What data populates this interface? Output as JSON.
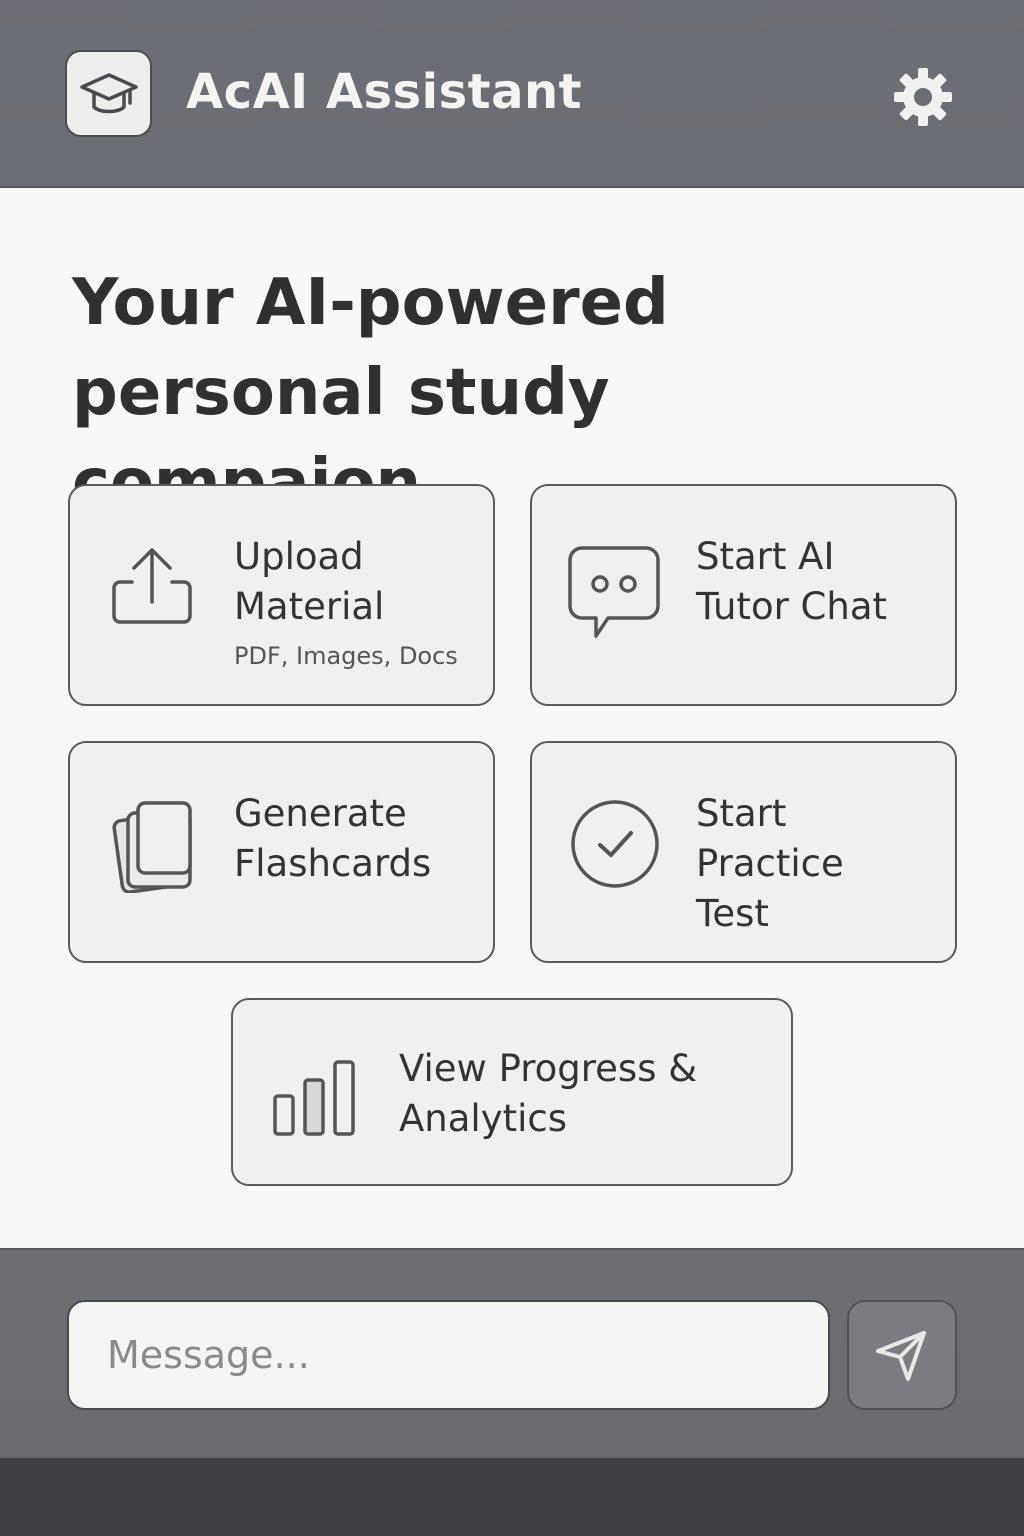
{
  "app": {
    "title": "AcAI Assistant",
    "logo_icon": "graduation-cap-icon",
    "settings_icon": "gear-icon"
  },
  "main": {
    "headline": "Your AI-powered personal study compaion.",
    "cards": [
      {
        "id": "upload",
        "label": "Upload Material",
        "sub": "PDF, Images, Docs",
        "icon": "upload-icon"
      },
      {
        "id": "chat",
        "label": "Start AI Tutor Chat",
        "icon": "chat-bubble-icon"
      },
      {
        "id": "flashcards",
        "label": "Generate Flashcards",
        "icon": "flashcards-icon"
      },
      {
        "id": "practice",
        "label": "Start Practice Test",
        "icon": "checkmark-circle-icon"
      },
      {
        "id": "progress",
        "label": "View Progress & Analytics",
        "icon": "bar-chart-icon"
      }
    ]
  },
  "footer": {
    "message_placeholder": "Message...",
    "send_icon": "send-icon"
  },
  "colors": {
    "header_bg": "#6e7077",
    "card_bg": "#f0f0f0",
    "text": "#333333",
    "bottom_bar": "#3f4145"
  }
}
